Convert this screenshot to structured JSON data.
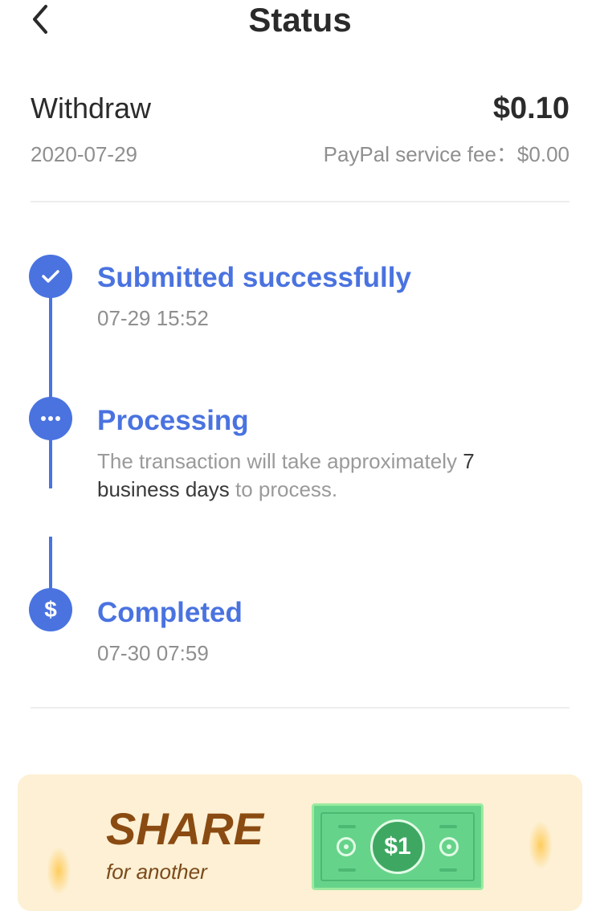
{
  "header": {
    "title": "Status",
    "back_icon": "chevron-left-icon"
  },
  "summary": {
    "title": "Withdraw",
    "amount": "$0.10",
    "date": "2020-07-29",
    "fee": "PayPal service fee：$0.00"
  },
  "timeline": [
    {
      "icon": "check-icon",
      "title": "Submitted successfully",
      "time": "07-29 15:52"
    },
    {
      "icon": "ellipsis-icon",
      "title": "Processing",
      "desc_before": "The transaction will take approximately ",
      "desc_highlight": "7 business days",
      "desc_after": " to process."
    },
    {
      "icon": "dollar-icon",
      "title": "Completed",
      "time": "07-30 07:59"
    }
  ],
  "banner": {
    "headline": "SHARE",
    "subline": "for another",
    "bill_label": "$1"
  },
  "colors": {
    "accent": "#4a73e0",
    "banner_bg": "#fdf0d4",
    "banner_text": "#8a4b12",
    "bill_green": "#66d38a"
  }
}
